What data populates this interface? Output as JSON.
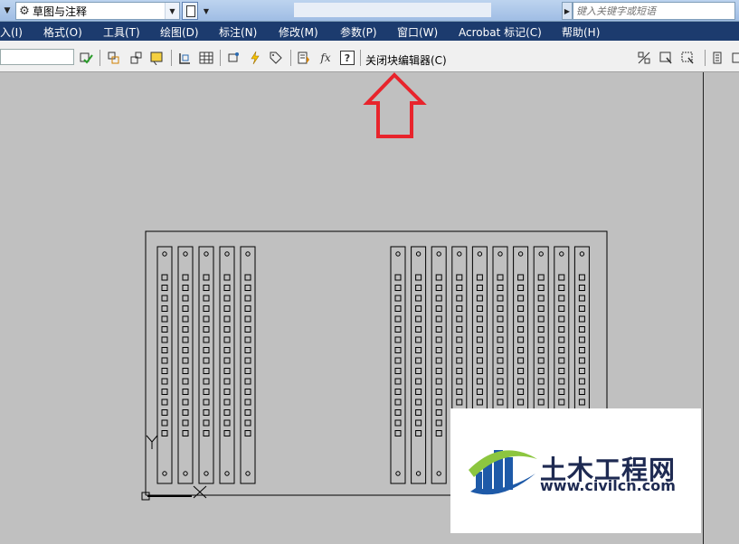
{
  "workspace": {
    "label": "草图与注释",
    "gear_icon": "gear-icon"
  },
  "search": {
    "placeholder": "键入关键字或短语"
  },
  "menubar": {
    "items": [
      {
        "label": "入(I)"
      },
      {
        "label": "格式(O)"
      },
      {
        "label": "工具(T)"
      },
      {
        "label": "绘图(D)"
      },
      {
        "label": "标注(N)"
      },
      {
        "label": "修改(M)"
      },
      {
        "label": "参数(P)"
      },
      {
        "label": "窗口(W)"
      },
      {
        "label": "Acrobat 标记(C)"
      },
      {
        "label": "帮助(H)"
      }
    ]
  },
  "toolbar": {
    "fx_label": "fx",
    "help_label": "?",
    "close_block_editor_label": "关闭块编辑器(C)"
  },
  "annotation": {
    "arrow_color": "#e8242c"
  },
  "drawing": {
    "left_group_strips": 5,
    "right_group_strips": 10,
    "holes_per_strip": 16,
    "line_color": "#000000"
  },
  "watermark": {
    "name": "土木工程网",
    "url": "www.civilcn.com"
  },
  "colors": {
    "menubar_bg": "#1c3b6e",
    "canvas_bg": "#c0c0c0",
    "logo_blue": "#1e5aa8",
    "logo_green": "#8cc63f"
  }
}
